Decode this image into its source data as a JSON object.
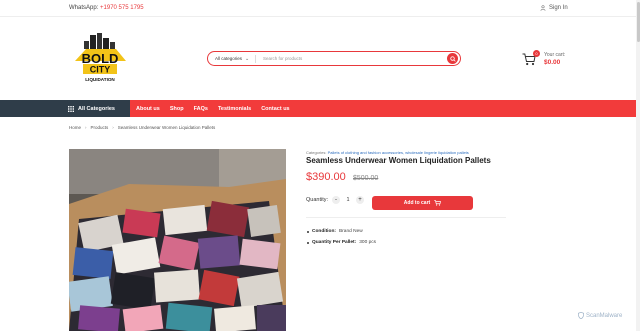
{
  "topbar": {
    "whatsapp_label": "WhatsApp:",
    "whatsapp_number": "+1970 575 1795",
    "signin": "Sign In"
  },
  "logo": {
    "line1": "BOLD",
    "line2": "CITY",
    "line3": "LIQUIDATION"
  },
  "search": {
    "category": "All categories",
    "placeholder": "Search for products"
  },
  "cart": {
    "count": "0",
    "label": "Your cart:",
    "amount": "$0.00"
  },
  "nav": {
    "all_categories": "All Categories",
    "items": [
      "About us",
      "Shop",
      "FAQs",
      "Testimonials",
      "Contact us"
    ]
  },
  "breadcrumb": [
    "Home",
    "Products",
    "Seamless Underwear Women Liquidation Pallets"
  ],
  "product": {
    "categories_label": "Categories:",
    "categories": "Pallets of clothing and fashion accessories, wholesale lingerie liquidation pallets",
    "title": "Seamless Underwear Women Liquidation Pallets",
    "price": "$390.00",
    "old_price": "$500.00",
    "quantity_label": "Quantity:",
    "quantity": "1",
    "add_to_cart": "Add to cart",
    "specs": [
      {
        "label": "Condition:",
        "value": "Brand New"
      },
      {
        "label": "Quantity Per Pallet:",
        "value": "300 pcs"
      }
    ]
  },
  "watermark": "ScanMalware",
  "colors": {
    "accent": "#e8383b",
    "nav_dark": "#2f3d49",
    "link": "#2e6fbf"
  }
}
